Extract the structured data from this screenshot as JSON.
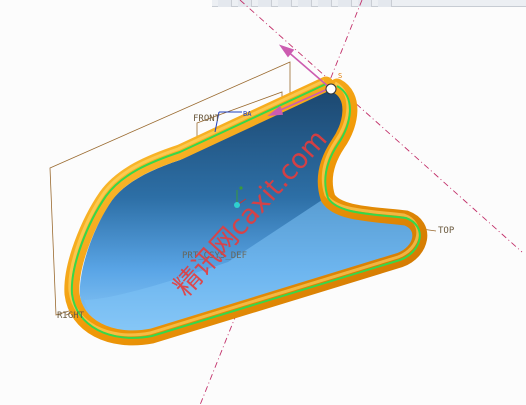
{
  "toolbar": {
    "buttons": [
      "rotate-icon",
      "pan-icon",
      "zoom-icon",
      "view-icon",
      "display-icon",
      "layer-icon",
      "datum-icon",
      "shade-icon",
      "wireframe-icon"
    ]
  },
  "datum_planes": {
    "front": "FRONT",
    "top": "TOP",
    "right": "RIGHT",
    "prt_csys": "PRT_CSYS_DEF"
  },
  "csys_label": "ВА",
  "start_point_label": "S",
  "watermark": "精讯网caxit.com",
  "colors": {
    "sweep_tube": "#f1a10f",
    "surface_dark": "#1f4f7a",
    "surface_light": "#7ec2f5",
    "trajectory": "#36d84a",
    "datum_plane": "#9a6a2f",
    "axis": "#c2306a"
  }
}
